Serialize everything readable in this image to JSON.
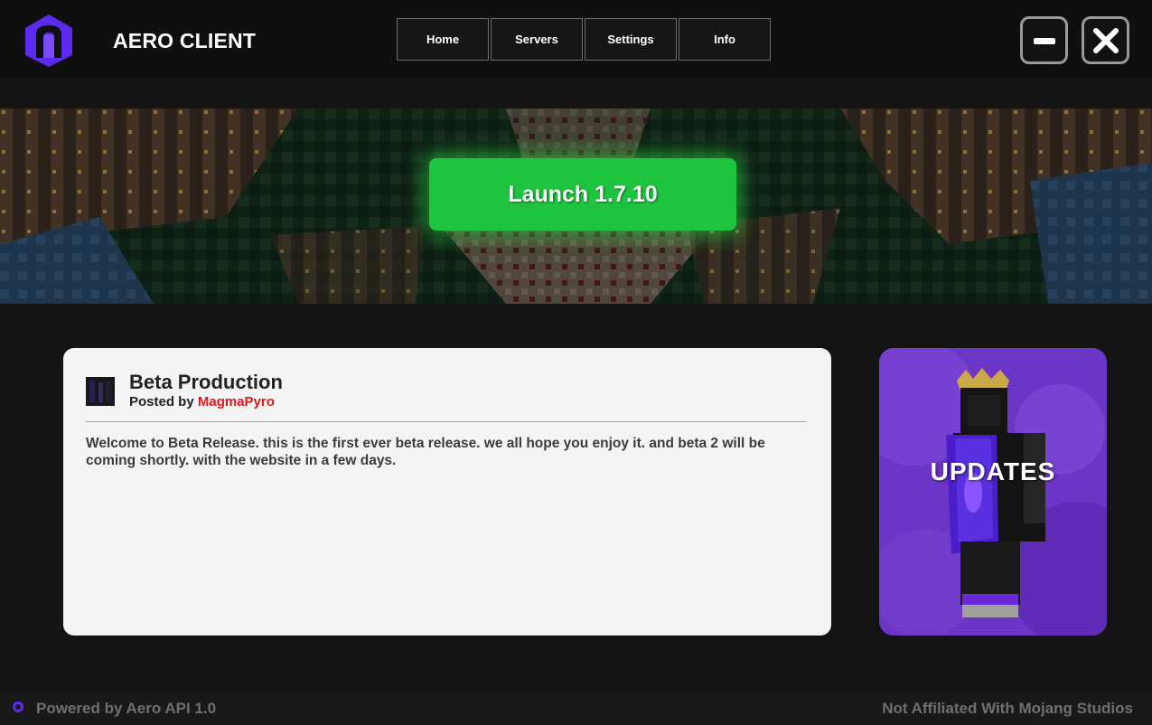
{
  "app": {
    "title": "AERO CLIENT",
    "accent_color": "#5b2bf0",
    "icon": "aero-logo-icon"
  },
  "nav": {
    "items": [
      {
        "label": "Home"
      },
      {
        "label": "Servers"
      },
      {
        "label": "Settings"
      },
      {
        "label": "Info"
      }
    ]
  },
  "window_controls": {
    "minimize_icon": "minimize-icon",
    "close_icon": "close-icon"
  },
  "hero": {
    "launch_label": "Launch 1.7.10",
    "launch_color": "#1ec43e"
  },
  "news": {
    "title": "Beta Production",
    "posted_by_prefix": "Posted by",
    "author": "MagmaPyro",
    "author_color": "#e01616",
    "body": "Welcome to Beta Release. this is the first ever beta release. we all hope you enjoy it. and beta 2 will be coming shortly. with the website in a few days."
  },
  "updates": {
    "label": "UPDATES",
    "background_color": "#6b35c6"
  },
  "footer": {
    "powered_by": "Powered by Aero API 1.0",
    "disclaimer": "Not Affiliated With Mojang Studios"
  }
}
